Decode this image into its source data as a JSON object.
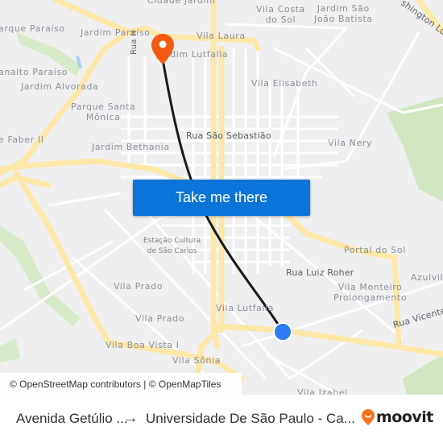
{
  "map": {
    "labels": {
      "cidade_jardim": "Cidade Jardim",
      "vila_costa_do_sol": "Vila Costa\ndo Sol",
      "jardim_sao_joao_batista": "Jardim São\nJoão Batista",
      "washington_luis": "shington Luís",
      "parque_paraiso": "arque Paraíso",
      "jardim_paraiso": "Jardim Paraíso",
      "vila_laura": "Vila Laura",
      "rua_h": "Rua H",
      "jardim_lutfalla": "Jardim Lutfalla",
      "planalto_paraiso": "analto Paraíso",
      "jardim_alvorada": "Jardim Alvorada",
      "vila_elisabeth": "Vila Elisabeth",
      "parque_santa_monica": "Parque Santa\nMônica",
      "rua_sao_sebastiao": "Rua São Sebastião",
      "faber_ii": "e Faber II",
      "vila_nery": "Vila Nery",
      "jardim_bethania": "Jardim Bethania",
      "estacao_cultura": "Estação Cultura\nde São Carlos",
      "portal_do_sol": "Portal do Sol",
      "rua_luiz_roher": "Rua Luiz Roher",
      "azulville": "Azulvil",
      "vila_monteiro": "Vila Monteiro\nProlongamento",
      "vila_prado_1": "Vila Prado",
      "vila_prado_2": "Vila Prado",
      "vila_lutfalla": "Vila Lutfalla",
      "rua_vicente": "Rua Vicente",
      "vila_boa_vista": "Vila Boa Vista I",
      "vila_sonia": "Vila Sônia",
      "vila_izabel": "Vila Izabel"
    },
    "colors": {
      "background": "#efefef",
      "major_road": "#fbe7a8",
      "minor_road": "#ffffff",
      "park": "#cfe6c0",
      "route": "#1a1a1a",
      "destination_pin": "#f25a14",
      "origin_dot": "#2e7bf3",
      "cta": "#0a74d9"
    }
  },
  "cta": {
    "label": "Take me there"
  },
  "attribution": {
    "text": "© OpenStreetMap contributors | © OpenMapTiles"
  },
  "footer": {
    "from": "Avenida Getúlio ...",
    "arrow": "→",
    "to": "Universidade De São Paulo - Ca...",
    "brand": "moovit"
  }
}
